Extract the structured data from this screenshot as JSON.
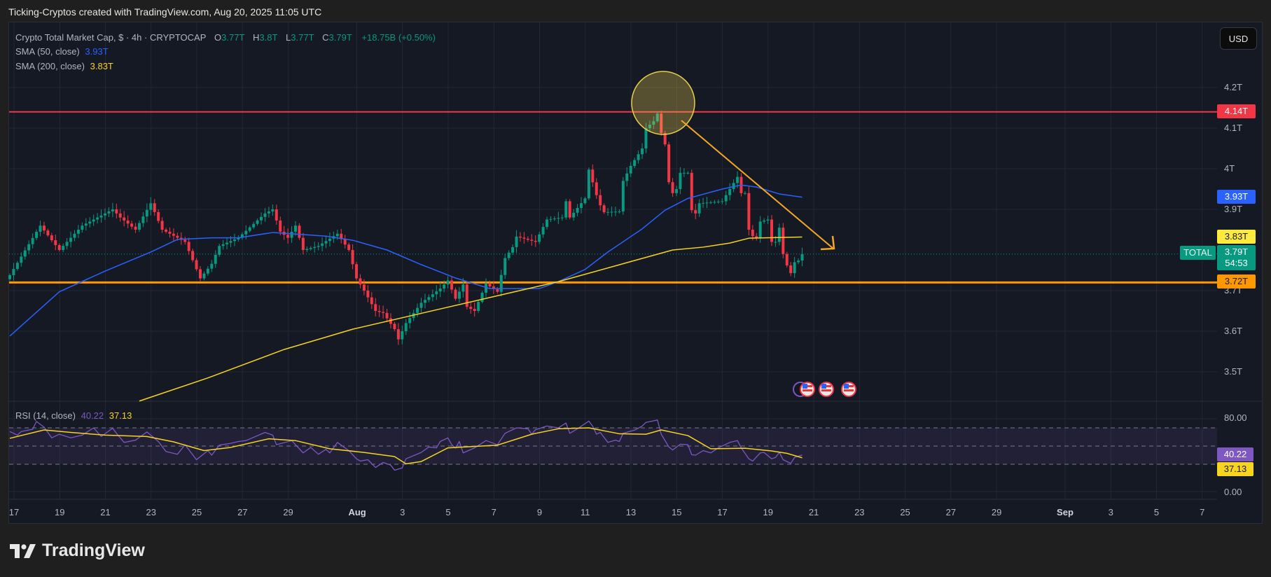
{
  "caption": "Ticking-Cryptos created with TradingView.com, Aug 20, 2025 11:05 UTC",
  "legend": {
    "symbol": "Crypto Total Market Cap, $ · 4h · CRYPTOCAP",
    "o_label": "O",
    "o": "3.77T",
    "h_label": "H",
    "h": "3.8T",
    "l_label": "L",
    "l": "3.77T",
    "c_label": "C",
    "c": "3.79T",
    "change": "+18.75B (+0.50%)",
    "sma50_label": "SMA (50, close)",
    "sma50_value": "3.93T",
    "sma200_label": "SMA (200, close)",
    "sma200_value": "3.83T",
    "rsi_label": "RSI (14, close)",
    "rsi_value": "40.22",
    "rsi_ma_value": "37.13"
  },
  "currency_button": "USD",
  "price_axis": [
    "4.2T",
    "4.1T",
    "4T",
    "3.9T",
    "3.7T",
    "3.6T",
    "3.5T"
  ],
  "price_axis_values": [
    4.2,
    4.1,
    4.0,
    3.9,
    3.7,
    3.6,
    3.5
  ],
  "rsi_axis": [
    "80.00",
    "0.00"
  ],
  "price_labels": {
    "resistance": "4.14T",
    "sma50": "3.93T",
    "sma200": "3.83T",
    "symbol_tag": "TOTAL",
    "last": "3.79T",
    "countdown": "54:53",
    "support": "3.72T",
    "rsi": "40.22",
    "rsi_ma": "37.13"
  },
  "colors": {
    "up": "#089981",
    "down": "#f23645",
    "sma50": "#2962ff",
    "sma200": "#f7d41f",
    "rsi": "#7e57c2",
    "resistance": "#f23645",
    "support": "#ff9800",
    "arrow": "#f5a623"
  },
  "logo": "TradingView",
  "chart_data": {
    "type": "candlestick",
    "title": "Crypto Total Market Cap, $ · 4h · CRYPTOCAP",
    "bar_interval": "4h",
    "ylim": [
      3.38,
      4.27
    ],
    "resistance": 4.14,
    "support": 3.72,
    "last": 3.79,
    "close_anchors": [
      [
        0,
        3.738
      ],
      [
        8,
        3.86
      ],
      [
        13,
        3.8
      ],
      [
        19,
        3.86
      ],
      [
        27,
        3.9
      ],
      [
        29,
        3.88
      ],
      [
        33,
        3.85
      ],
      [
        37,
        3.915
      ],
      [
        40,
        3.85
      ],
      [
        46,
        3.82
      ],
      [
        50,
        3.73
      ],
      [
        53,
        3.766
      ],
      [
        55,
        3.81
      ],
      [
        60,
        3.83
      ],
      [
        67,
        3.89
      ],
      [
        69,
        3.9
      ],
      [
        71,
        3.845
      ],
      [
        73,
        3.83
      ],
      [
        75,
        3.86
      ],
      [
        77,
        3.8
      ],
      [
        81,
        3.81
      ],
      [
        86,
        3.84
      ],
      [
        89,
        3.8
      ],
      [
        91,
        3.73
      ],
      [
        93,
        3.7
      ],
      [
        96,
        3.65
      ],
      [
        98,
        3.645
      ],
      [
        101,
        3.605
      ],
      [
        102,
        3.58
      ],
      [
        104,
        3.62
      ],
      [
        108,
        3.67
      ],
      [
        113,
        3.705
      ],
      [
        115,
        3.725
      ],
      [
        117,
        3.68
      ],
      [
        119,
        3.715
      ],
      [
        120,
        3.66
      ],
      [
        122,
        3.65
      ],
      [
        125,
        3.717
      ],
      [
        128,
        3.697
      ],
      [
        130,
        3.78
      ],
      [
        132,
        3.807
      ],
      [
        133,
        3.833
      ],
      [
        138,
        3.82
      ],
      [
        141,
        3.875
      ],
      [
        145,
        3.88
      ],
      [
        146,
        3.92
      ],
      [
        147,
        3.88
      ],
      [
        151,
        3.927
      ],
      [
        152,
        3.998
      ],
      [
        154,
        3.935
      ],
      [
        155,
        3.91
      ],
      [
        156,
        3.893
      ],
      [
        160,
        3.895
      ],
      [
        161,
        3.97
      ],
      [
        163,
        4.007
      ],
      [
        166,
        4.05
      ],
      [
        167,
        4.1
      ],
      [
        169,
        4.117
      ],
      [
        170,
        4.136
      ],
      [
        171,
        4.088
      ],
      [
        172,
        4.06
      ],
      [
        173,
        3.967
      ],
      [
        174,
        3.94
      ],
      [
        175,
        3.95
      ],
      [
        176,
        3.99
      ],
      [
        178,
        3.99
      ],
      [
        179,
        3.898
      ],
      [
        180,
        3.89
      ],
      [
        181,
        3.915
      ],
      [
        187,
        3.92
      ],
      [
        189,
        3.95
      ],
      [
        191,
        3.98
      ],
      [
        192,
        3.94
      ],
      [
        193,
        3.94
      ],
      [
        194,
        3.85
      ],
      [
        195,
        3.834
      ],
      [
        196,
        3.83
      ],
      [
        197,
        3.87
      ],
      [
        199,
        3.875
      ],
      [
        200,
        3.82
      ],
      [
        201,
        3.82
      ],
      [
        202,
        3.855
      ],
      [
        203,
        3.79
      ],
      [
        204,
        3.762
      ],
      [
        205,
        3.743
      ],
      [
        206,
        3.77
      ],
      [
        207,
        3.774
      ],
      [
        208,
        3.79
      ]
    ],
    "sma50": [
      [
        0,
        3.588
      ],
      [
        13,
        3.697
      ],
      [
        25,
        3.748
      ],
      [
        37,
        3.795
      ],
      [
        44,
        3.826
      ],
      [
        53,
        3.83
      ],
      [
        60,
        3.83
      ],
      [
        69,
        3.843
      ],
      [
        77,
        3.838
      ],
      [
        83,
        3.834
      ],
      [
        90,
        3.824
      ],
      [
        99,
        3.8
      ],
      [
        108,
        3.764
      ],
      [
        117,
        3.731
      ],
      [
        126,
        3.705
      ],
      [
        139,
        3.705
      ],
      [
        144,
        3.722
      ],
      [
        151,
        3.752
      ],
      [
        157,
        3.795
      ],
      [
        166,
        3.852
      ],
      [
        172,
        3.898
      ],
      [
        178,
        3.927
      ],
      [
        187,
        3.95
      ],
      [
        192,
        3.96
      ],
      [
        196,
        3.955
      ],
      [
        202,
        3.938
      ],
      [
        208,
        3.93
      ]
    ],
    "sma200": [
      [
        34,
        3.428
      ],
      [
        52,
        3.485
      ],
      [
        72,
        3.555
      ],
      [
        90,
        3.605
      ],
      [
        144,
        3.722
      ],
      [
        174,
        3.8
      ],
      [
        182,
        3.807
      ],
      [
        189,
        3.817
      ],
      [
        194,
        3.829
      ],
      [
        208,
        3.832
      ]
    ],
    "rsi": [
      [
        0,
        66
      ],
      [
        2,
        62
      ],
      [
        3,
        66
      ],
      [
        6,
        68.5
      ],
      [
        7,
        77
      ],
      [
        9,
        70.8
      ],
      [
        11,
        59
      ],
      [
        13,
        63
      ],
      [
        16,
        59
      ],
      [
        19,
        62
      ],
      [
        22,
        70
      ],
      [
        24,
        60.5
      ],
      [
        27,
        69.6
      ],
      [
        28,
        64
      ],
      [
        30,
        54
      ],
      [
        33,
        56.5
      ],
      [
        36,
        65.5
      ],
      [
        39,
        55
      ],
      [
        41,
        44
      ],
      [
        44,
        41
      ],
      [
        46,
        51.5
      ],
      [
        49,
        35
      ],
      [
        52,
        45
      ],
      [
        53,
        40
      ],
      [
        55,
        51
      ],
      [
        58,
        53
      ],
      [
        60,
        55
      ],
      [
        62,
        56
      ],
      [
        67,
        65
      ],
      [
        69,
        62
      ],
      [
        70,
        51.5
      ],
      [
        74,
        56
      ],
      [
        77,
        42.5
      ],
      [
        79,
        48.5
      ],
      [
        81,
        41
      ],
      [
        83,
        46.4
      ],
      [
        84,
        42.5
      ],
      [
        86,
        54
      ],
      [
        89,
        45
      ],
      [
        91,
        36
      ],
      [
        92,
        33.5
      ],
      [
        94,
        35
      ],
      [
        96,
        26.5
      ],
      [
        98,
        32
      ],
      [
        100,
        29
      ],
      [
        101,
        23.5
      ],
      [
        103,
        26
      ],
      [
        104,
        36
      ],
      [
        108,
        43
      ],
      [
        110,
        49
      ],
      [
        112,
        48
      ],
      [
        113,
        55
      ],
      [
        115,
        59
      ],
      [
        116,
        51.5
      ],
      [
        117,
        47.7
      ],
      [
        118,
        55
      ],
      [
        119,
        42.5
      ],
      [
        122,
        48
      ],
      [
        125,
        56
      ],
      [
        128,
        51.5
      ],
      [
        130,
        64
      ],
      [
        133,
        70
      ],
      [
        136,
        69
      ],
      [
        137,
        63
      ],
      [
        138,
        68
      ],
      [
        141,
        72
      ],
      [
        144,
        70
      ],
      [
        146,
        75.3
      ],
      [
        147,
        64
      ],
      [
        149,
        69
      ],
      [
        152,
        77.4
      ],
      [
        153,
        71.8
      ],
      [
        154,
        63
      ],
      [
        155,
        65
      ],
      [
        157,
        54
      ],
      [
        159,
        56.5
      ],
      [
        160,
        55
      ],
      [
        161,
        64
      ],
      [
        164,
        67.5
      ],
      [
        166,
        72
      ],
      [
        167,
        76
      ],
      [
        170,
        78.6
      ],
      [
        171,
        63
      ],
      [
        173,
        49
      ],
      [
        174,
        45.7
      ],
      [
        176,
        52
      ],
      [
        178,
        51.5
      ],
      [
        179,
        40.5
      ],
      [
        180,
        40
      ],
      [
        182,
        45
      ],
      [
        184,
        42.5
      ],
      [
        186,
        48
      ],
      [
        189,
        54
      ],
      [
        191,
        56
      ],
      [
        192,
        48
      ],
      [
        194,
        36
      ],
      [
        195,
        33.5
      ],
      [
        197,
        42.5
      ],
      [
        198,
        43
      ],
      [
        200,
        36
      ],
      [
        201,
        37.5
      ],
      [
        202,
        43
      ],
      [
        203,
        35
      ],
      [
        205,
        31
      ],
      [
        206,
        37.5
      ],
      [
        208,
        40.22
      ]
    ],
    "rsi_ma": [
      [
        0,
        58.5
      ],
      [
        9,
        67.7
      ],
      [
        16,
        65
      ],
      [
        25,
        62
      ],
      [
        36,
        60.5
      ],
      [
        43,
        54.6
      ],
      [
        51,
        45
      ],
      [
        58,
        48.5
      ],
      [
        68,
        58
      ],
      [
        75,
        56
      ],
      [
        84,
        47
      ],
      [
        93,
        43
      ],
      [
        101,
        38.5
      ],
      [
        104,
        30.5
      ],
      [
        108,
        33
      ],
      [
        115,
        48
      ],
      [
        128,
        51
      ],
      [
        137,
        63
      ],
      [
        144,
        69
      ],
      [
        152,
        70
      ],
      [
        160,
        63.5
      ],
      [
        167,
        63
      ],
      [
        171,
        67.7
      ],
      [
        178,
        61.5
      ],
      [
        184,
        47
      ],
      [
        193,
        47.6
      ],
      [
        200,
        44.6
      ],
      [
        204,
        42
      ],
      [
        208,
        37.13
      ]
    ],
    "rsi_levels": [
      70,
      50,
      30
    ],
    "x_ticks": [
      {
        "label": "17",
        "day": 0,
        "bold": false
      },
      {
        "label": "19",
        "day": 2,
        "bold": false
      },
      {
        "label": "21",
        "day": 4,
        "bold": false
      },
      {
        "label": "23",
        "day": 6,
        "bold": false
      },
      {
        "label": "25",
        "day": 8,
        "bold": false
      },
      {
        "label": "27",
        "day": 10,
        "bold": false
      },
      {
        "label": "29",
        "day": 12,
        "bold": false
      },
      {
        "label": "Aug",
        "day": 15,
        "bold": true
      },
      {
        "label": "3",
        "day": 17,
        "bold": false
      },
      {
        "label": "5",
        "day": 19,
        "bold": false
      },
      {
        "label": "7",
        "day": 21,
        "bold": false
      },
      {
        "label": "9",
        "day": 23,
        "bold": false
      },
      {
        "label": "11",
        "day": 25,
        "bold": false
      },
      {
        "label": "13",
        "day": 27,
        "bold": false
      },
      {
        "label": "15",
        "day": 29,
        "bold": false
      },
      {
        "label": "17",
        "day": 31,
        "bold": false
      },
      {
        "label": "19",
        "day": 33,
        "bold": false
      },
      {
        "label": "21",
        "day": 35,
        "bold": false
      },
      {
        "label": "23",
        "day": 37,
        "bold": false
      },
      {
        "label": "25",
        "day": 39,
        "bold": false
      },
      {
        "label": "27",
        "day": 41,
        "bold": false
      },
      {
        "label": "29",
        "day": 43,
        "bold": false
      },
      {
        "label": "Sep",
        "day": 46,
        "bold": true
      },
      {
        "label": "3",
        "day": 48,
        "bold": false
      },
      {
        "label": "5",
        "day": 50,
        "bold": false
      },
      {
        "label": "7",
        "day": 52,
        "bold": false
      }
    ],
    "annotations": {
      "peak_circle_at_bar": 170,
      "trend_arrow": "down from Aug 14 high toward 3.80T"
    }
  }
}
